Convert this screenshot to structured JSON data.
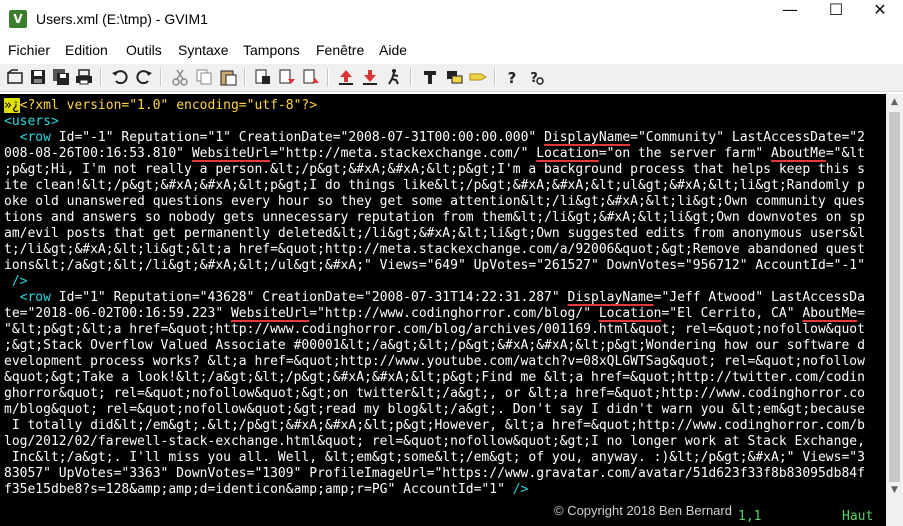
{
  "window": {
    "title": "Users.xml (E:\\tmp) - GVIM1",
    "icon_label": "V",
    "minimize_glyph": "—",
    "maximize_glyph": "☐",
    "close_glyph": "✕"
  },
  "menu": {
    "items": [
      "Fichier",
      "Edition",
      "Outils",
      "Syntaxe",
      "Tampons",
      "Fenêtre",
      "Aide"
    ]
  },
  "toolbar": {
    "icons": [
      "open-icon",
      "save-icon",
      "save-all-icon",
      "print-icon",
      "undo-icon",
      "redo-icon",
      "cut-icon",
      "copy-icon",
      "paste-icon",
      "replace-icon",
      "find-next-icon",
      "find-prev-icon",
      "load-session-icon",
      "save-session-icon",
      "run-script-icon",
      "make-icon",
      "build-tags-icon",
      "tag-jump-icon",
      "help-icon",
      "find-help-icon"
    ]
  },
  "editor": {
    "lines": [
      [
        {
          "t": "»¿",
          "c": "cursor"
        },
        {
          "t": "<?xml version=\"1.0\" encoding=\"utf-8\"?>",
          "c": "t-pi"
        }
      ],
      [
        {
          "t": "<users>",
          "c": "t-tag"
        }
      ],
      [
        {
          "t": "  <row ",
          "c": "t-tag"
        },
        {
          "t": "Id=\"-1\" Reputation=\"1\" CreationDate=\"2008-07-31T00:00:00.000\" ",
          "c": "t-attr"
        },
        {
          "t": "DisplayName",
          "c": "t-attr u-red"
        },
        {
          "t": "=\"Community\" LastAccessDate=\"2",
          "c": "t-attr"
        }
      ],
      [
        {
          "t": "008-08-26T00:16:53.810\" ",
          "c": "t-attr"
        },
        {
          "t": "WebsiteUrl",
          "c": "t-attr u-red"
        },
        {
          "t": "=\"http://meta.stackexchange.com/\" ",
          "c": "t-attr"
        },
        {
          "t": "Location",
          "c": "t-attr u-red"
        },
        {
          "t": "=\"on the server farm\" ",
          "c": "t-attr"
        },
        {
          "t": "AboutMe",
          "c": "t-attr u-red"
        },
        {
          "t": "=\"&lt",
          "c": "t-attr"
        }
      ],
      [
        {
          "t": ";p&gt;Hi, I'm not really a person.&lt;/p&gt;&#xA;&#xA;&lt;p&gt;I'm a background process that helps keep this s",
          "c": "t-val"
        }
      ],
      [
        {
          "t": "ite clean!&lt;/p&gt;&#xA;&#xA;&lt;p&gt;I do things like&lt;/p&gt;&#xA;&#xA;&lt;ul&gt;&#xA;&lt;li&gt;Randomly p",
          "c": "t-val"
        }
      ],
      [
        {
          "t": "oke old unanswered questions every hour so they get some attention&lt;/li&gt;&#xA;&lt;li&gt;Own community ques",
          "c": "t-val"
        }
      ],
      [
        {
          "t": "tions and answers so nobody gets unnecessary reputation from them&lt;/li&gt;&#xA;&lt;li&gt;Own downvotes on sp",
          "c": "t-val"
        }
      ],
      [
        {
          "t": "am/evil posts that get permanently deleted&lt;/li&gt;&#xA;&lt;li&gt;Own suggested edits from anonymous users&l",
          "c": "t-val"
        }
      ],
      [
        {
          "t": "t;/li&gt;&#xA;&lt;li&gt;&lt;a href=&quot;http://meta.stackexchange.com/a/92006&quot;&gt;Remove abandoned quest",
          "c": "t-val"
        }
      ],
      [
        {
          "t": "ions&lt;/a&gt;&lt;/li&gt;&#xA;&lt;/ul&gt;&#xA;\" Views=\"649\" UpVotes=\"261527\" DownVotes=\"956712\" AccountId=\"-1\"",
          "c": "t-val"
        }
      ],
      [
        {
          "t": " />",
          "c": "t-tag"
        }
      ],
      [
        {
          "t": "  <row ",
          "c": "t-tag"
        },
        {
          "t": "Id=\"1\" Reputation=\"43628\" CreationDate=\"2008-07-31T14:22:31.287\" ",
          "c": "t-attr"
        },
        {
          "t": "DisplayName",
          "c": "t-attr u-red"
        },
        {
          "t": "=\"Jeff Atwood\" LastAccessDa",
          "c": "t-attr"
        }
      ],
      [
        {
          "t": "te=\"2018-06-02T00:16:59.223\" ",
          "c": "t-attr"
        },
        {
          "t": "WebsiteUrl",
          "c": "t-attr u-red"
        },
        {
          "t": "=\"http://www.codinghorror.com/blog/\" ",
          "c": "t-attr"
        },
        {
          "t": "Location",
          "c": "t-attr u-red"
        },
        {
          "t": "=\"El Cerrito, CA\" ",
          "c": "t-attr"
        },
        {
          "t": "AboutMe",
          "c": "t-attr u-red"
        },
        {
          "t": "=",
          "c": "t-attr"
        }
      ],
      [
        {
          "t": "\"&lt;p&gt;&lt;a href=&quot;http://www.codinghorror.com/blog/archives/001169.html&quot; rel=&quot;nofollow&quot",
          "c": "t-val"
        }
      ],
      [
        {
          "t": ";&gt;Stack Overflow Valued Associate #00001&lt;/a&gt;&lt;/p&gt;&#xA;&#xA;&lt;p&gt;Wondering how our software d",
          "c": "t-val"
        }
      ],
      [
        {
          "t": "evelopment process works? &lt;a href=&quot;http://www.youtube.com/watch?v=08xQLGWTSag&quot; rel=&quot;nofollow",
          "c": "t-val"
        }
      ],
      [
        {
          "t": "&quot;&gt;Take a look!&lt;/a&gt;&lt;/p&gt;&#xA;&#xA;&lt;p&gt;Find me &lt;a href=&quot;http://twitter.com/codin",
          "c": "t-val"
        }
      ],
      [
        {
          "t": "ghorror&quot; rel=&quot;nofollow&quot;&gt;on twitter&lt;/a&gt;, or &lt;a href=&quot;http://www.codinghorror.co",
          "c": "t-val"
        }
      ],
      [
        {
          "t": "m/blog&quot; rel=&quot;nofollow&quot;&gt;read my blog&lt;/a&gt;. Don't say I didn't warn you &lt;em&gt;because",
          "c": "t-val"
        }
      ],
      [
        {
          "t": " I totally did&lt;/em&gt;.&lt;/p&gt;&#xA;&#xA;&lt;p&gt;However, &lt;a href=&quot;http://www.codinghorror.com/b",
          "c": "t-val"
        }
      ],
      [
        {
          "t": "log/2012/02/farewell-stack-exchange.html&quot; rel=&quot;nofollow&quot;&gt;I no longer work at Stack Exchange,",
          "c": "t-val"
        }
      ],
      [
        {
          "t": " Inc&lt;/a&gt;. I'll miss you all. Well, &lt;em&gt;some&lt;/em&gt; of you, anyway. :)&lt;/p&gt;&#xA;\" Views=\"3",
          "c": "t-val"
        }
      ],
      [
        {
          "t": "83057\" UpVotes=\"3363\" DownVotes=\"1309\" ProfileImageUrl=\"https://www.gravatar.com/avatar/51d623f33f8b83095db84f",
          "c": "t-val"
        }
      ],
      [
        {
          "t": "f35e15dbe8?s=128&amp;amp;d=identicon&amp;amp;r=PG\" AccountId=\"1\" ",
          "c": "t-val"
        },
        {
          "t": "/>",
          "c": "t-tag"
        }
      ],
      [
        {
          "t": "###",
          "c": "tilde"
        }
      ]
    ]
  },
  "status": {
    "copyright": "© Copyright 2018 Ben Bernard",
    "position": "1,1",
    "scroll": "Haut"
  }
}
